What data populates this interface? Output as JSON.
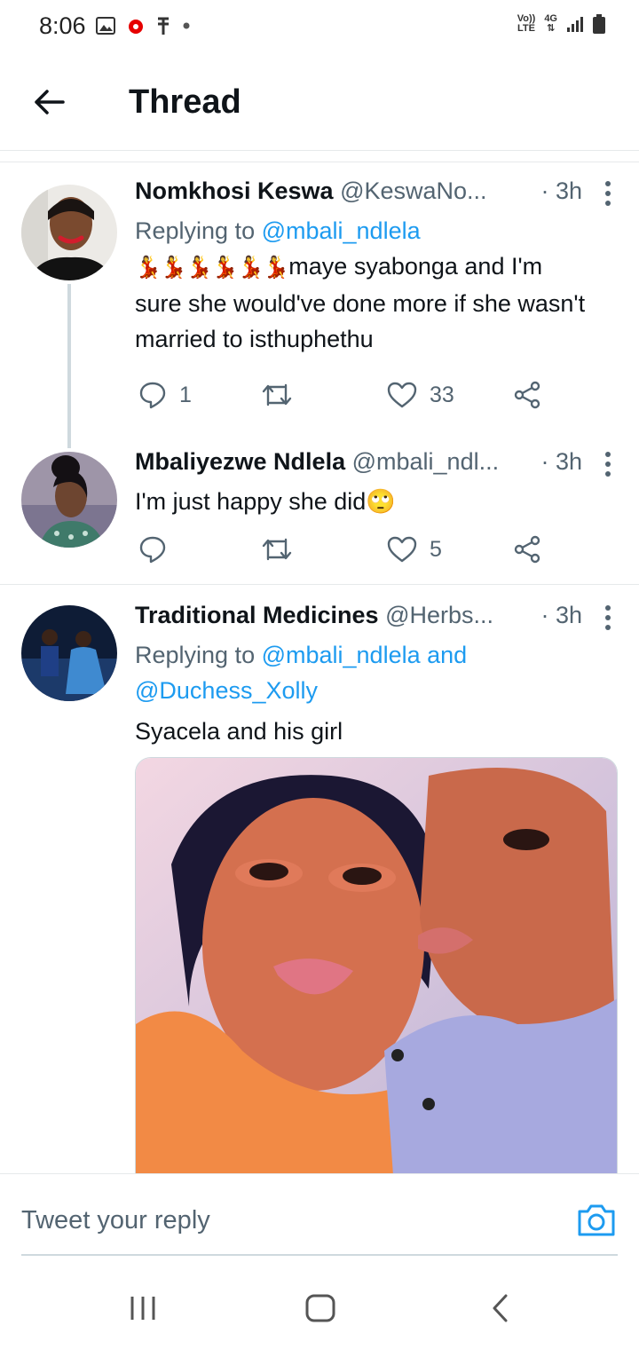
{
  "status_bar": {
    "time": "8:06",
    "volte": "Vo))",
    "lte": "LTE",
    "network": "4G"
  },
  "header": {
    "title": "Thread"
  },
  "tweets": [
    {
      "name": "Nomkhosi Keswa",
      "handle": "@KeswaNo...",
      "time": "· 3h",
      "replying_prefix": "Replying to ",
      "replying_to": "@mbali_ndlela",
      "emoji": "💃💃💃💃💃💃",
      "text_first": "maye syabonga and I'm",
      "text_rest": "sure she would've done more if she wasn't married to isthuphethu",
      "replies": "1",
      "retweets": "",
      "likes": "33"
    },
    {
      "name": "Mbaliyezwe Ndlela",
      "handle": "@mbali_ndl...",
      "time": "· 3h",
      "text": "I'm just happy she did",
      "emoji": "🙄",
      "replies": "",
      "retweets": "",
      "likes": "5"
    },
    {
      "name": "Traditional Medicines",
      "handle": "@Herbs...",
      "time": "· 3h",
      "replying_prefix": "Replying to ",
      "replying_to": "@mbali_ndlela and",
      "replying_to_2": "@Duchess_Xolly",
      "text": "Syacela and his girl"
    }
  ],
  "reply_box": {
    "placeholder": "Tweet your reply"
  },
  "colors": {
    "accent": "#1d9bf0",
    "secondary_text": "#536471",
    "divider": "#e6e9eb"
  }
}
